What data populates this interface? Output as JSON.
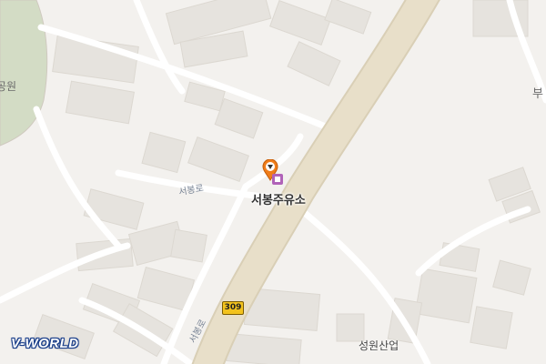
{
  "map": {
    "labels": {
      "park": "공원",
      "edge": "부",
      "poi": "서봉주유소",
      "company": "성원산업",
      "street_1": "서봉로",
      "street_2": "서봉로"
    },
    "route_shield": "309",
    "logo": "V-WORLD",
    "colors": {
      "background": "#f3f1ee",
      "park": "#d3dcc5",
      "highway": "#e8dfc9",
      "road": "#ffffff",
      "building": "#e6e3de",
      "pin": "#f07d1a",
      "poi_icon": "#b062b8",
      "route_shield": "#f2c21d",
      "logo_outline": "#1b3f8a"
    },
    "icons": [
      "map-pin-icon",
      "gas-station-icon"
    ]
  }
}
